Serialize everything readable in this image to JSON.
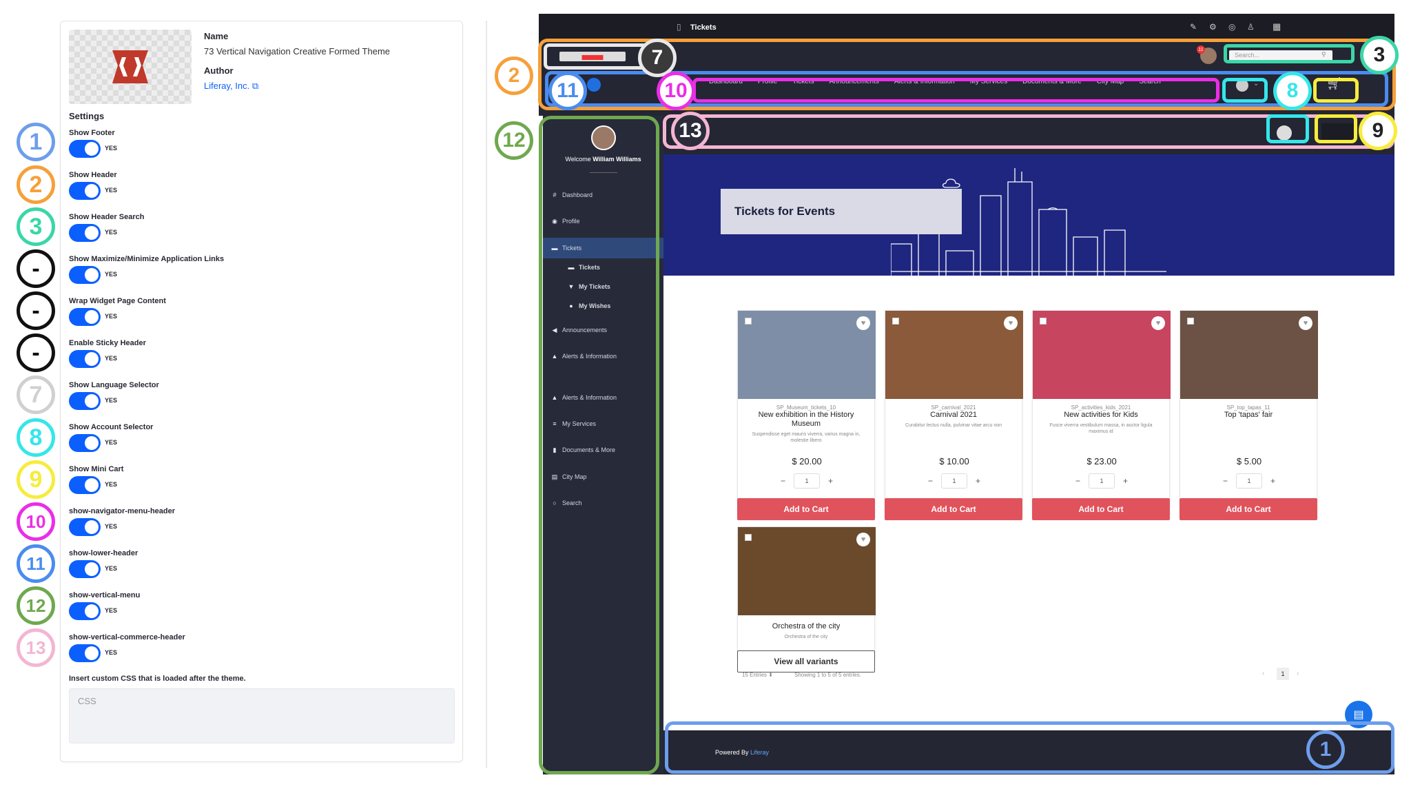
{
  "left_legend": [
    {
      "label": "1",
      "color": "#6d9eeb"
    },
    {
      "label": "2",
      "color": "#f6a03a"
    },
    {
      "label": "3",
      "color": "#3bd6a7"
    },
    {
      "label": "-",
      "color": "#111111"
    },
    {
      "label": "-",
      "color": "#111111"
    },
    {
      "label": "-",
      "color": "#111111"
    },
    {
      "label": "7",
      "color": "#d0d0d0"
    },
    {
      "label": "8",
      "color": "#35e6ea"
    },
    {
      "label": "9",
      "color": "#f7ec3c"
    },
    {
      "label": "10",
      "color": "#ea2ee6"
    },
    {
      "label": "11",
      "color": "#4a8cf0"
    },
    {
      "label": "12",
      "color": "#6fa84f"
    },
    {
      "label": "13",
      "color": "#f3b6d2"
    }
  ],
  "theme": {
    "name_label": "Name",
    "name_value": "73 Vertical Navigation Creative Formed Theme",
    "author_label": "Author",
    "author_value": "Liferay, Inc."
  },
  "settings_title": "Settings",
  "settings": [
    {
      "label": "Show Footer",
      "value": "YES"
    },
    {
      "label": "Show Header",
      "value": "YES"
    },
    {
      "label": "Show Header Search",
      "value": "YES"
    },
    {
      "label": "Show Maximize/Minimize Application Links",
      "value": "YES"
    },
    {
      "label": "Wrap Widget Page Content",
      "value": "YES"
    },
    {
      "label": "Enable Sticky Header",
      "value": "YES"
    },
    {
      "label": "Show Language Selector",
      "value": "YES"
    },
    {
      "label": "Show Account Selector",
      "value": "YES"
    },
    {
      "label": "Show Mini Cart",
      "value": "YES"
    },
    {
      "label": "show-navigator-menu-header",
      "value": "YES"
    },
    {
      "label": "show-lower-header",
      "value": "YES"
    },
    {
      "label": "show-vertical-menu",
      "value": "YES"
    },
    {
      "label": "show-vertical-commerce-header",
      "value": "YES"
    }
  ],
  "custom_css": {
    "label": "Insert custom CSS that is loaded after the theme.",
    "placeholder": "CSS"
  },
  "app": {
    "page_title": "Tickets",
    "search_placeholder": "Search...",
    "notif_count": "11"
  },
  "nav": [
    "Dashboard",
    "Profile",
    "Tickets",
    "Announcements",
    "Alerts & Information",
    "My Services",
    "Documents & More",
    "City Map",
    "Search"
  ],
  "sidebar": {
    "welcome": "Welcome",
    "user": "William Williams",
    "items": [
      {
        "label": "Dashboard",
        "icon": "#"
      },
      {
        "label": "Profile",
        "icon": "◉"
      },
      {
        "label": "Tickets",
        "icon": "▬"
      },
      {
        "label": "Tickets",
        "icon": "▬"
      },
      {
        "label": "My Tickets",
        "icon": "▼"
      },
      {
        "label": "My Wishes",
        "icon": "●"
      },
      {
        "label": "Announcements",
        "icon": "◀"
      },
      {
        "label": "Alerts & Information",
        "icon": "▲"
      },
      {
        "label": "Alerts & Information",
        "icon": "▲"
      },
      {
        "label": "My Services",
        "icon": "≡"
      },
      {
        "label": "Documents & More",
        "icon": "▮"
      },
      {
        "label": "City Map",
        "icon": "▤"
      },
      {
        "label": "Search",
        "icon": "○"
      }
    ]
  },
  "banner_title": "Tickets for Events",
  "products": [
    {
      "sku": "SP_Museum_tickets_10",
      "name": "New exhibition in the History Museum",
      "desc": "Suspendisse eget mauris viverra, varius magna in, molestie libero",
      "price": "$ 20.00",
      "qty": "1",
      "button": "Add to Cart",
      "img": "#7d8ea6"
    },
    {
      "sku": "SP_carnival_2021",
      "name": "Carnival 2021",
      "desc": "Curabitur lectus nulla, pulvinar vitae arcu non",
      "price": "$ 10.00",
      "qty": "1",
      "button": "Add to Cart",
      "img": "#8a5a3a"
    },
    {
      "sku": "SP_activities_kids_2021",
      "name": "New activities for Kids",
      "desc": "Fusce viverra vestibulum massa, in auctor ligula maximus id",
      "price": "$ 23.00",
      "qty": "1",
      "button": "Add to Cart",
      "img": "#c7455f"
    },
    {
      "sku": "SP_top_tapas_11",
      "name": "Top 'tapas' fair",
      "desc": "",
      "price": "$ 5.00",
      "qty": "1",
      "button": "Add to Cart",
      "img": "#6b5244"
    },
    {
      "sku": "",
      "name": "Orchestra of the city",
      "desc": "Orchestra of the city",
      "price": "",
      "qty": "",
      "button": "View all variants",
      "img": "#6b4a2c"
    }
  ],
  "pagination": {
    "entries": "15 Entries ⬍",
    "showing": "Showing 1 to 5 of 5 entries.",
    "page": "1"
  },
  "footer": {
    "powered": "Powered By",
    "brand": "Liferay"
  },
  "annotations": {
    "n1": "1",
    "n2": "2",
    "n3": "3",
    "n7": "7",
    "n8": "8",
    "n9": "9",
    "n10": "10",
    "n11": "11",
    "n12": "12",
    "n13": "13"
  }
}
